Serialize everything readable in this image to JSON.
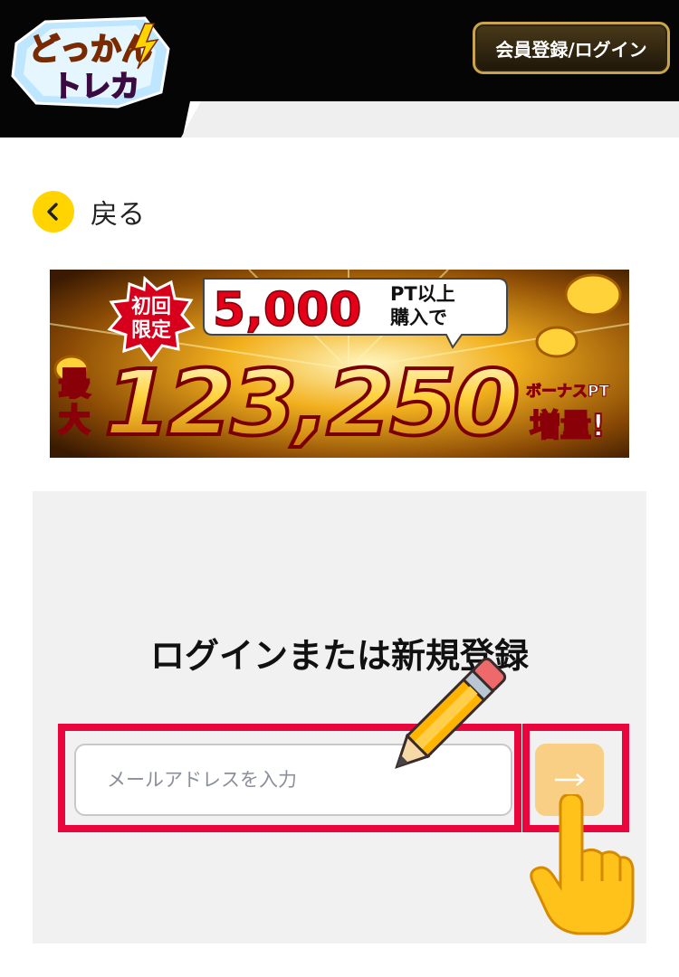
{
  "header": {
    "logo_text_top": "どっかん",
    "logo_text_bottom": "トレカ",
    "login_register_label": "会員登録/ログイン"
  },
  "back": {
    "icon": "chevron-left-icon",
    "label": "戻る"
  },
  "banner": {
    "badge_line1": "初回",
    "badge_line2": "限定",
    "amount": "5,000",
    "pt_line1": "PT以上",
    "pt_line2": "購入で",
    "max_line1": "最",
    "max_line2": "大",
    "bonus_amount": "123,250",
    "bonus_label": "ボーナスPT",
    "increase_label": "増量!"
  },
  "login": {
    "title": "ログインまたは新規登録",
    "email_placeholder": "メールアドレスを入力",
    "email_value": "",
    "submit_icon": "arrow-right-icon"
  },
  "overlays": {
    "pencil_icon": "pencil-icon",
    "hand_icon": "pointing-hand-icon",
    "highlight_color": "#e8063c"
  },
  "colors": {
    "header_bg": "#050505",
    "accent_yellow": "#ffd400",
    "submit_bg": "#f9cf86",
    "panel_bg": "#f1f1f1"
  }
}
